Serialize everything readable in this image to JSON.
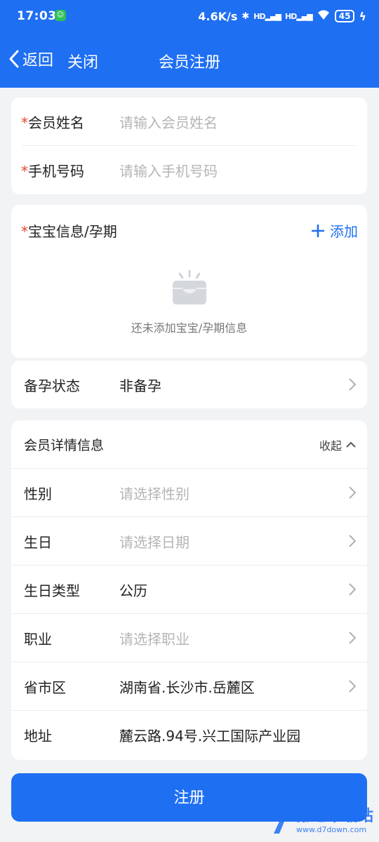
{
  "status_bar": {
    "time": "17:03",
    "speed": "4.6K/s",
    "signal1": "HD",
    "signal2": "HD",
    "battery": "45"
  },
  "nav": {
    "back_label": "返回",
    "close_label": "关闭",
    "title": "会员注册"
  },
  "basic": {
    "name": {
      "star": "*",
      "label": "会员姓名",
      "placeholder": "请输入会员姓名"
    },
    "phone": {
      "star": "*",
      "label": "手机号码",
      "placeholder": "请输入手机号码"
    }
  },
  "baby": {
    "star": "*",
    "label": "宝宝信息/孕期",
    "add_label": "添加",
    "empty_text": "还未添加宝宝/孕期信息"
  },
  "pregnancy": {
    "label": "备孕状态",
    "value": "非备孕"
  },
  "details": {
    "title": "会员详情信息",
    "collapse_label": "收起",
    "rows": [
      {
        "label": "性别",
        "placeholder": "请选择性别"
      },
      {
        "label": "生日",
        "placeholder": "请选择日期"
      },
      {
        "label": "生日类型",
        "value": "公历"
      },
      {
        "label": "职业",
        "placeholder": "请选择职业"
      },
      {
        "label": "省市区",
        "value": "湖南省.长沙市.岳麓区"
      },
      {
        "label": "地址",
        "value": "麓云路.94号.兴工国际产业园"
      }
    ]
  },
  "submit_label": "注册",
  "watermark": {
    "title": "第七下载站",
    "url": "www.d7down.com"
  },
  "colors": {
    "primary": "#1f6ff2",
    "required": "#e8452c",
    "placeholder": "#b5b5b5",
    "background": "#f2f3f5"
  }
}
